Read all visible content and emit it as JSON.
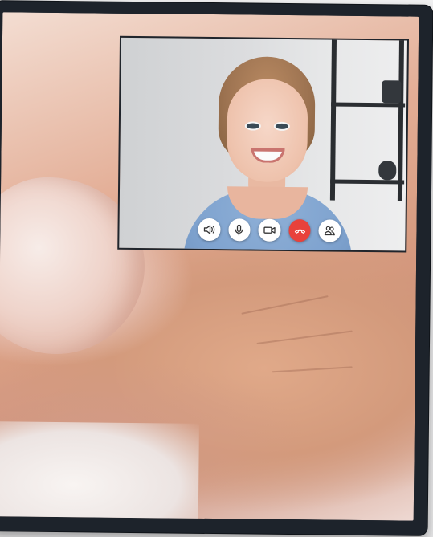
{
  "scene": {
    "description_hidden": ""
  },
  "video_call": {
    "controls": [
      {
        "id": "speaker",
        "icon": "speaker-icon"
      },
      {
        "id": "microphone",
        "icon": "microphone-icon"
      },
      {
        "id": "camera",
        "icon": "video-camera-icon"
      },
      {
        "id": "end_call",
        "icon": "hang-up-icon",
        "color": "#e8413b"
      },
      {
        "id": "participants",
        "icon": "participants-icon"
      }
    ]
  },
  "colors": {
    "end_call": "#e8413b",
    "monitor_bezel": "#1d232b",
    "shirt": "#7fa3cf"
  }
}
